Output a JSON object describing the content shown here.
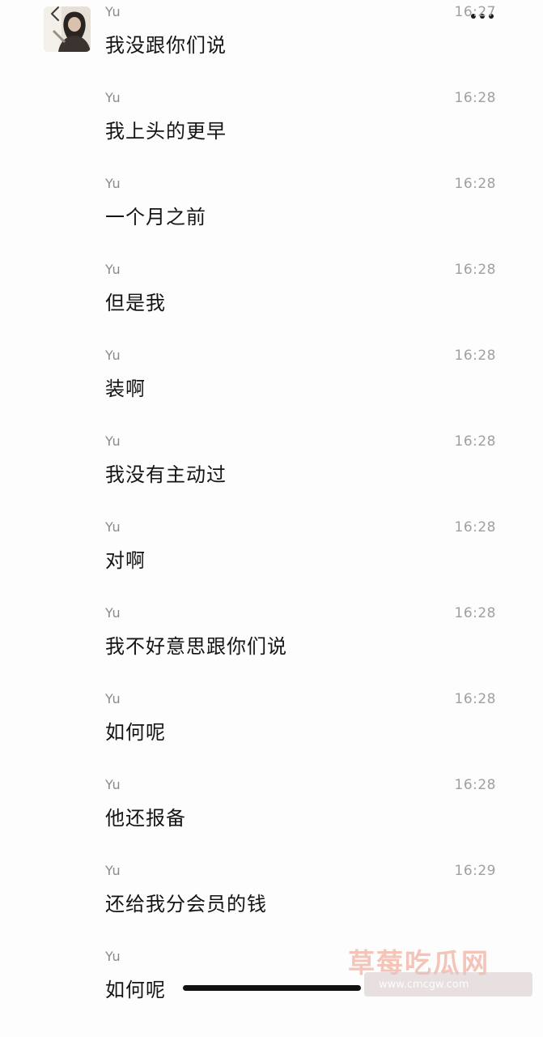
{
  "chat": {
    "messages": [
      {
        "sender": "Yu",
        "time": "16:27",
        "text": "我没跟你们说"
      },
      {
        "sender": "Yu",
        "time": "16:28",
        "text": "我上头的更早"
      },
      {
        "sender": "Yu",
        "time": "16:28",
        "text": "一个月之前"
      },
      {
        "sender": "Yu",
        "time": "16:28",
        "text": "但是我"
      },
      {
        "sender": "Yu",
        "time": "16:28",
        "text": "装啊"
      },
      {
        "sender": "Yu",
        "time": "16:28",
        "text": "我没有主动过"
      },
      {
        "sender": "Yu",
        "time": "16:28",
        "text": "对啊"
      },
      {
        "sender": "Yu",
        "time": "16:28",
        "text": "我不好意思跟你们说"
      },
      {
        "sender": "Yu",
        "time": "16:28",
        "text": "如何呢"
      },
      {
        "sender": "Yu",
        "time": "16:28",
        "text": "他还报备"
      },
      {
        "sender": "Yu",
        "time": "16:29",
        "text": "还给我分会员的钱"
      },
      {
        "sender": "Yu",
        "time": "",
        "text": "如何呢"
      }
    ]
  },
  "icons": {
    "back": "chevron-left-icon",
    "more": "more-dots-icon",
    "avatar": "user-avatar-photo"
  },
  "watermark": {
    "title": "草莓吃瓜网",
    "url": "www.cmcgw.com"
  },
  "colors": {
    "background": "#fdfdfd",
    "text": "#141414",
    "meta": "#8a8a8a",
    "watermark": "#ec9682"
  }
}
